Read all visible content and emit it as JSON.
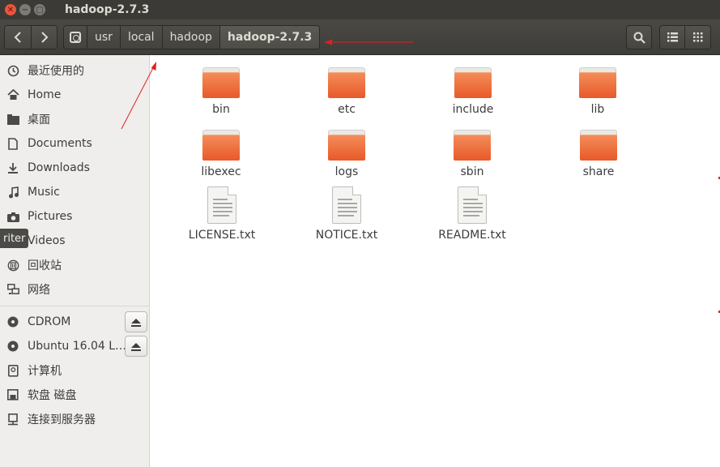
{
  "window": {
    "title": "hadoop-2.7.3"
  },
  "toolbar": {
    "back_icon": "chevron-left-icon",
    "forward_icon": "chevron-right-icon",
    "breadcrumb": [
      "usr",
      "local",
      "hadoop",
      "hadoop-2.7.3"
    ],
    "search_icon": "search-icon",
    "list_view_icon": "list-view-icon",
    "grid_view_icon": "grid-view-icon"
  },
  "sidebar": {
    "places": [
      {
        "label": "最近使用的",
        "icon": "clock-icon"
      },
      {
        "label": "Home",
        "icon": "home-icon"
      },
      {
        "label": "桌面",
        "icon": "desktop-folder-icon"
      },
      {
        "label": "Documents",
        "icon": "document-icon"
      },
      {
        "label": "Downloads",
        "icon": "download-icon"
      },
      {
        "label": "Music",
        "icon": "music-icon"
      },
      {
        "label": "Pictures",
        "icon": "camera-icon"
      },
      {
        "label": "Videos",
        "icon": "video-icon"
      },
      {
        "label": "回收站",
        "icon": "trash-icon"
      },
      {
        "label": "网络",
        "icon": "network-icon"
      }
    ],
    "devices": [
      {
        "label": "CDROM",
        "icon": "disc-icon",
        "eject": true
      },
      {
        "label": "Ubuntu 16.04 L…",
        "icon": "disc-icon",
        "eject": true
      },
      {
        "label": "计算机",
        "icon": "computer-icon",
        "eject": false
      },
      {
        "label": "软盘 磁盘",
        "icon": "floppy-icon",
        "eject": false
      },
      {
        "label": "连接到服务器",
        "icon": "server-icon",
        "eject": false
      }
    ],
    "tooltip": "riter"
  },
  "files": {
    "folders": [
      "bin",
      "etc",
      "include",
      "lib",
      "libexec",
      "logs",
      "sbin",
      "share"
    ],
    "documents": [
      "LICENSE.txt",
      "NOTICE.txt",
      "README.txt"
    ]
  },
  "colors": {
    "folder": "#e8592a",
    "annotation_arrow": "#e02020",
    "titlebar": "#3b3a36"
  }
}
